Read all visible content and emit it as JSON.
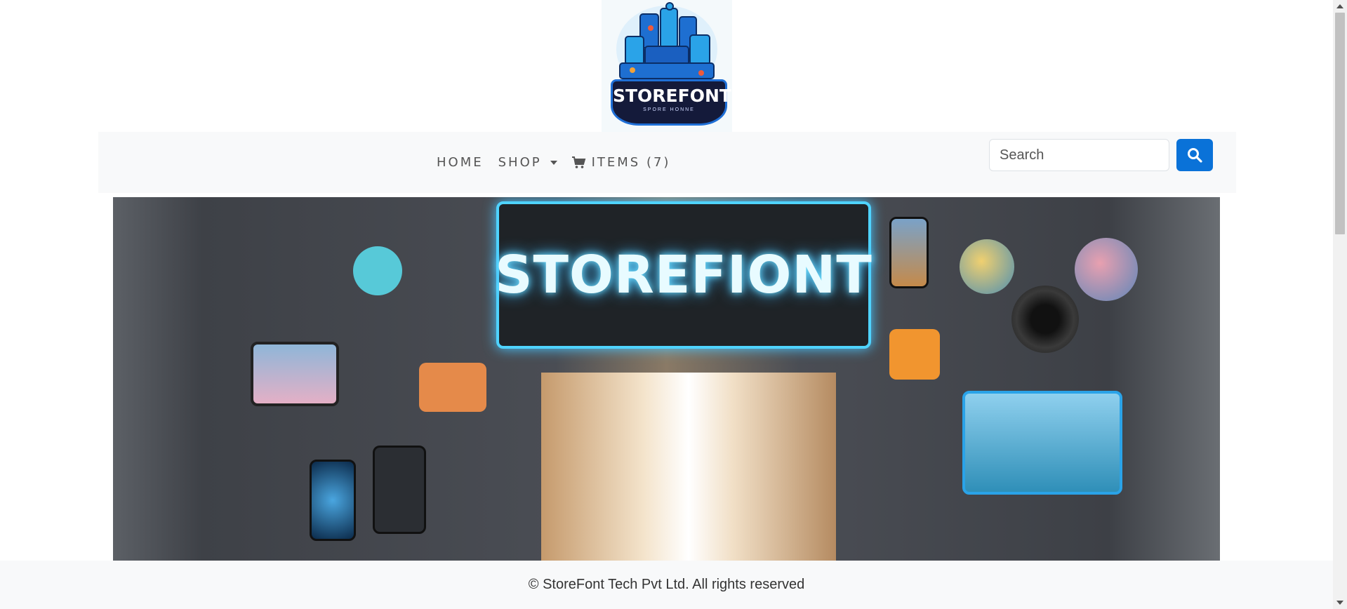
{
  "logo": {
    "title": "STOREFONT",
    "subtitle": "SPORE HONNE"
  },
  "nav": {
    "home": "HOME",
    "shop": "SHOP",
    "cart_label": "ITEMS (7)",
    "icons": {
      "shop": "caret-down-icon",
      "cart": "cart-icon"
    }
  },
  "search": {
    "placeholder": "Search",
    "value": "",
    "button_icon": "search-icon"
  },
  "hero": {
    "sign_text": "STOREFIONT"
  },
  "footer": {
    "text": "© StoreFont Tech Pvt Ltd. All rights reserved"
  },
  "colors": {
    "accent": "#0a72d8",
    "navbar_bg": "#f8f9fa",
    "footer_bg": "#f8f9fa",
    "logo_badge": "#141a3a",
    "neon": "#4fd3ff"
  }
}
